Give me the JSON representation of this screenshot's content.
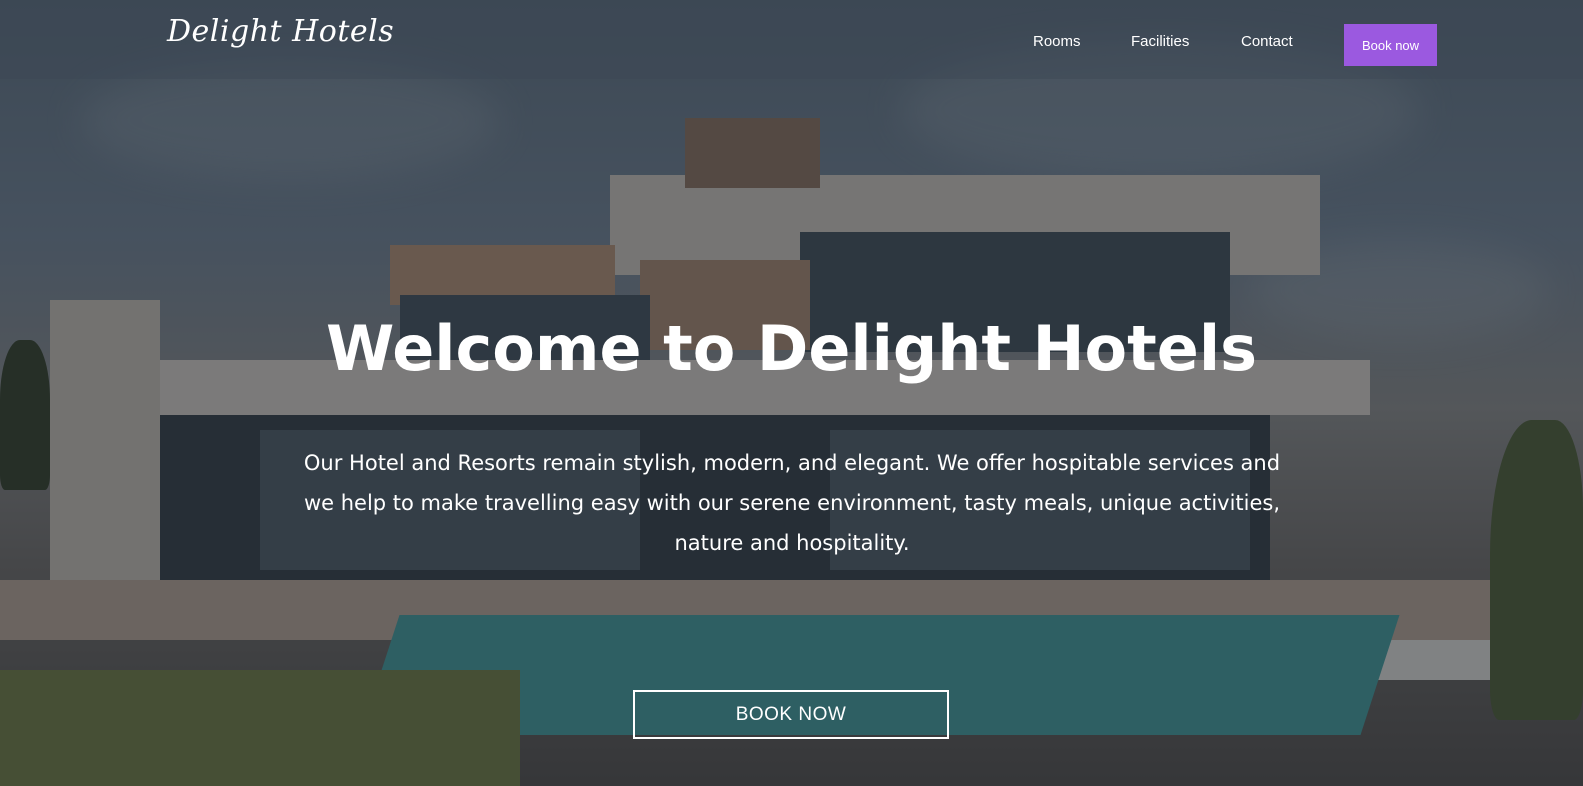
{
  "brand": {
    "logo_text": "Delight Hotels"
  },
  "nav": {
    "links": [
      {
        "label": "Rooms"
      },
      {
        "label": "Facilities"
      },
      {
        "label": "Contact"
      }
    ],
    "book_button": "Book now"
  },
  "hero": {
    "title": "Welcome to Delight Hotels",
    "text": "Our Hotel and Resorts remain stylish, modern, and elegant. We offer hospitable services and we help to make travelling easy with our serene environment, tasty meals, unique activities, nature and hospitality.",
    "cta_label": "BOOK NOW"
  },
  "colors": {
    "accent": "#9b59e0",
    "overlay": "#1e242c"
  },
  "background_image": "modern-hotel-with-pool"
}
